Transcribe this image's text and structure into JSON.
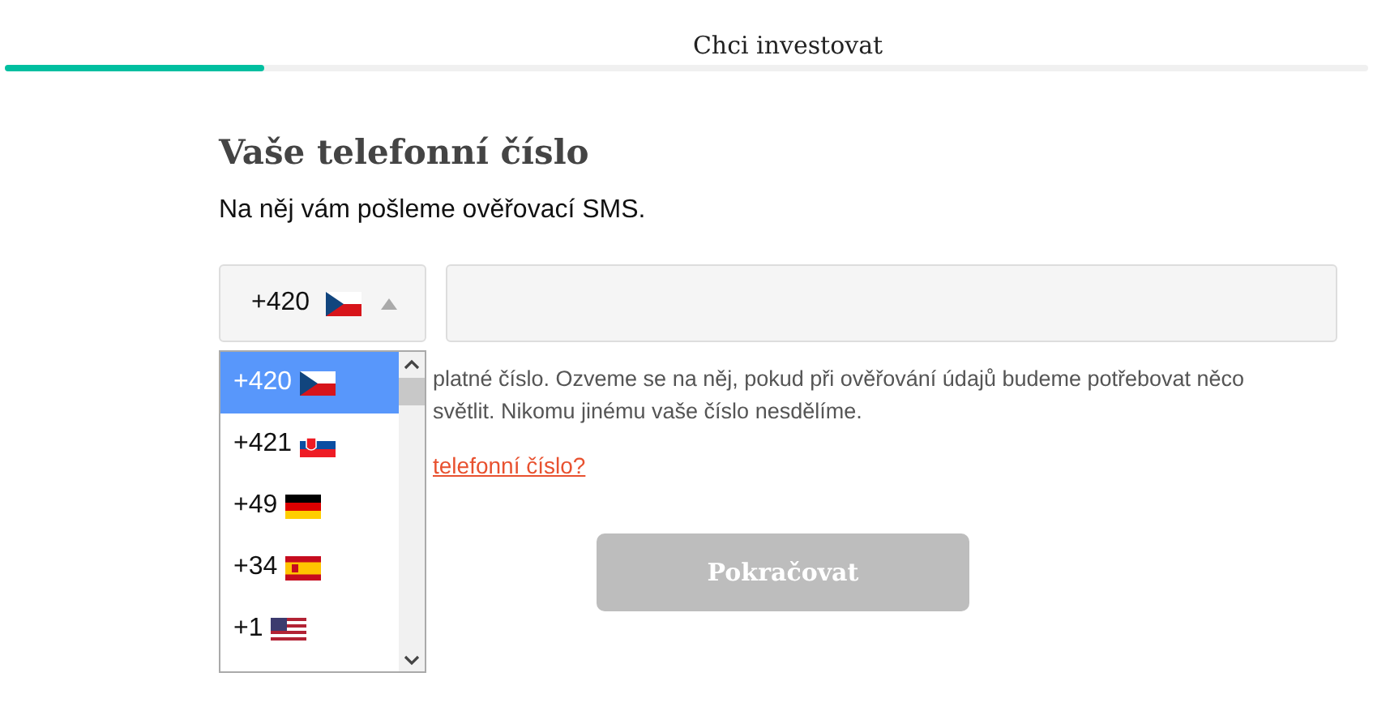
{
  "header": {
    "title": "Chci investovat",
    "progress": {
      "level": 0.19
    }
  },
  "heading": "Vaše telefonní číslo",
  "subtitle": "Na něj vám pošleme ověřovací SMS.",
  "country_select": {
    "value": "+420",
    "kind": "cz",
    "expanded": true
  },
  "dropdown_options": [
    {
      "code": "+420",
      "kind": "cz",
      "selected": true
    },
    {
      "code": "+421",
      "kind": "sk",
      "selected": false
    },
    {
      "code": "+49",
      "kind": "de",
      "selected": false
    },
    {
      "code": "+34",
      "kind": "es",
      "selected": false
    },
    {
      "code": "+1",
      "kind": "us",
      "selected": false
    }
  ],
  "hint_lines": [
    "platné číslo. Ozveme se na něj, pokud při ověřování údajů budeme potřebovat něco",
    "světlit. Nikomu jinému vaše číslo nesdělíme."
  ],
  "link": "telefonní číslo?",
  "continue_button": {
    "label": "Pokračovat",
    "disabled": true
  }
}
